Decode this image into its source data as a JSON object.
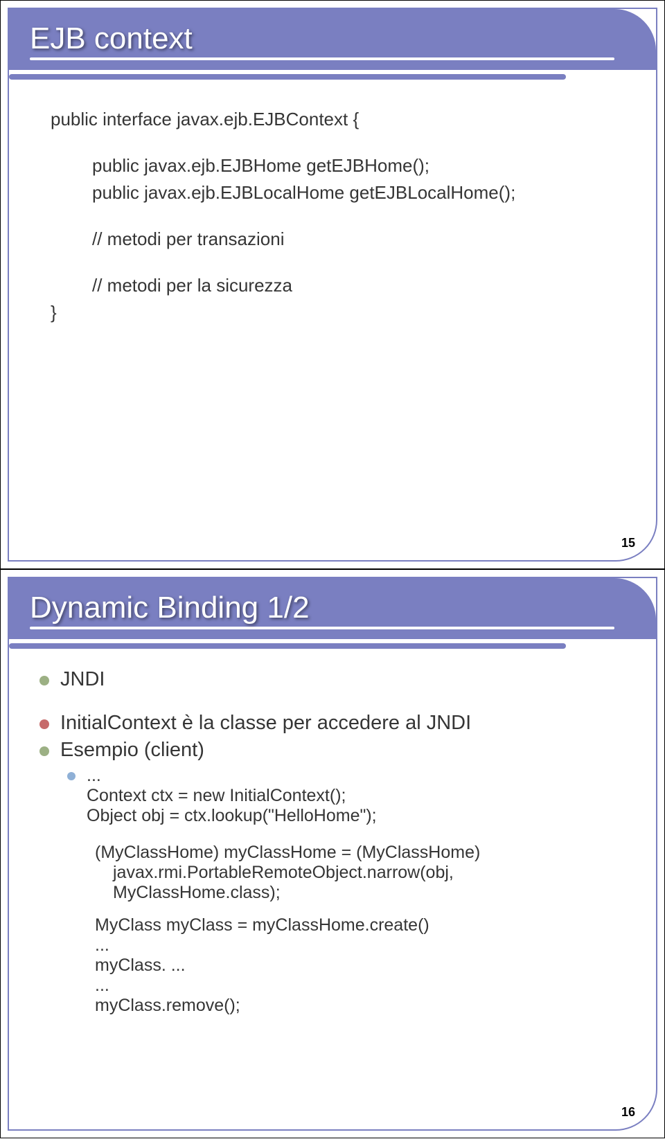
{
  "slide1": {
    "title": "EJB context",
    "code": {
      "l1": "public interface javax.ejb.EJBContext {",
      "l2": "public javax.ejb.EJBHome getEJBHome();",
      "l3": "public javax.ejb.EJBLocalHome getEJBLocalHome();",
      "l4": "// metodi per transazioni",
      "l5": "// metodi per la sicurezza",
      "l6": "}"
    },
    "page": "15"
  },
  "slide2": {
    "title": "Dynamic Binding 1/2",
    "bullets": {
      "b1": "JNDI",
      "b2": "InitialContext è la classe per accedere al JNDI",
      "b3": "Esempio (client)",
      "b4_a": "...",
      "b4_b": "Context ctx = new InitialContext();",
      "b4_c": "Object obj = ctx.lookup(\"HelloHome\");",
      "b4_d": "(MyClassHome) myClassHome = (MyClassHome)",
      "b4_e": "javax.rmi.PortableRemoteObject.narrow(obj, MyClassHome.class);",
      "b4_f": "MyClass myClass = myClassHome.create()",
      "b4_g": "...",
      "b4_h": "myClass. ...",
      "b4_i": "...",
      "b4_j": "myClass.remove();"
    },
    "page": "16"
  }
}
